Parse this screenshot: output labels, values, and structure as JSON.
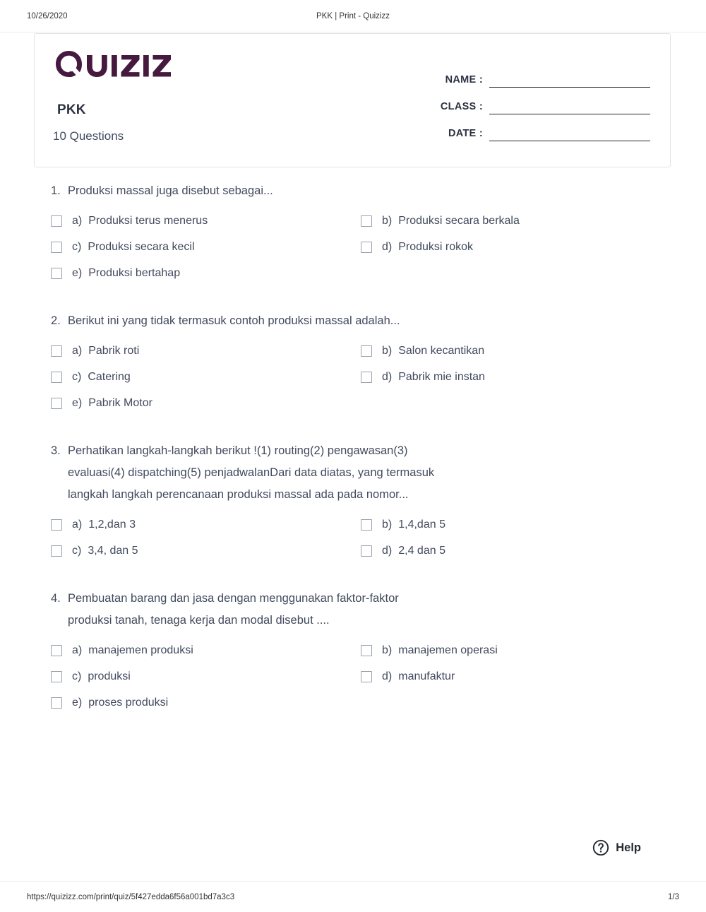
{
  "print_header": {
    "date": "10/26/2020",
    "title": "PKK | Print - Quizizz"
  },
  "print_footer": {
    "url": "https://quizizz.com/print/quiz/5f427edda6f56a001bd7a3c3",
    "page": "1/3"
  },
  "header_card": {
    "brand": "Quizizz",
    "brand_color": "#46193f",
    "quiz_title": "PKK",
    "question_count": "10 Questions",
    "fields": [
      {
        "label": "NAME :"
      },
      {
        "label": "CLASS :"
      },
      {
        "label": "DATE :"
      }
    ]
  },
  "questions": [
    {
      "number": "1.",
      "text": "Produksi massal juga disebut sebagai...",
      "options": [
        {
          "letter": "a)",
          "text": "Produksi terus menerus"
        },
        {
          "letter": "b)",
          "text": "Produksi secara berkala"
        },
        {
          "letter": "c)",
          "text": "Produksi secara kecil"
        },
        {
          "letter": "d)",
          "text": "Produksi rokok"
        },
        {
          "letter": "e)",
          "text": "Produksi bertahap"
        }
      ]
    },
    {
      "number": "2.",
      "text": "Berikut ini yang tidak termasuk contoh produksi massal adalah...",
      "options": [
        {
          "letter": "a)",
          "text": "Pabrik roti"
        },
        {
          "letter": "b)",
          "text": "Salon kecantikan"
        },
        {
          "letter": "c)",
          "text": "Catering"
        },
        {
          "letter": "d)",
          "text": "Pabrik mie instan"
        },
        {
          "letter": "e)",
          "text": "Pabrik Motor"
        }
      ]
    },
    {
      "number": "3.",
      "text": "Perhatikan langkah-langkah berikut !(1) routing(2) pengawasan(3) evaluasi(4) dispatching(5) penjadwalanDari data diatas, yang termasuk langkah langkah perencanaan produksi massal ada pada nomor...",
      "options": [
        {
          "letter": "a)",
          "text": "1,2,dan 3"
        },
        {
          "letter": "b)",
          "text": "1,4,dan 5"
        },
        {
          "letter": "c)",
          "text": "3,4, dan 5"
        },
        {
          "letter": "d)",
          "text": "2,4 dan 5"
        }
      ]
    },
    {
      "number": "4.",
      "text": "Pembuatan barang dan jasa dengan menggunakan faktor-faktor produksi tanah, tenaga kerja dan modal disebut ....",
      "options": [
        {
          "letter": "a)",
          "text": "manajemen produksi"
        },
        {
          "letter": "b)",
          "text": "manajemen operasi"
        },
        {
          "letter": "c)",
          "text": "produksi"
        },
        {
          "letter": "d)",
          "text": "manufaktur"
        },
        {
          "letter": "e)",
          "text": "proses produksi"
        }
      ]
    }
  ],
  "help_widget": {
    "label": "Help"
  }
}
